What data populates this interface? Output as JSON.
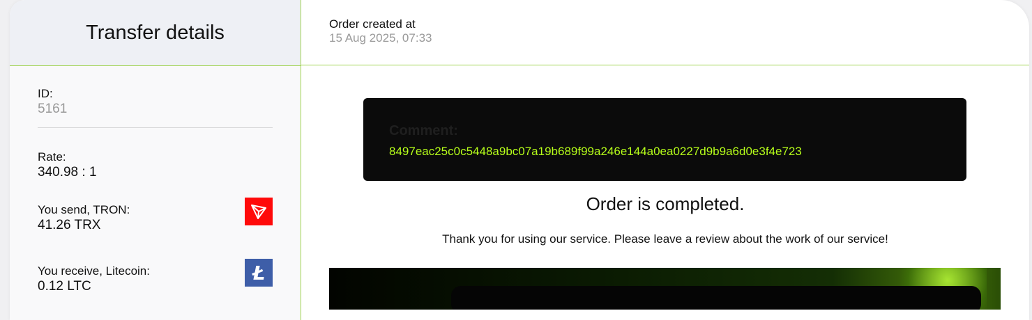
{
  "transfer": {
    "title": "Transfer details",
    "id_label": "ID:",
    "id_value": "5161",
    "rate_label": "Rate:",
    "rate_value": "340.98 : 1",
    "send_label": "You send, TRON:",
    "send_value": "41.26 TRX",
    "send_icon": "tron-icon",
    "receive_label": "You receive, Litecoin:",
    "receive_value": "0.12 LTC",
    "receive_icon": "litecoin-icon",
    "receive_icon_glyph": "Ł"
  },
  "order": {
    "created_label": "Order created at",
    "created_value": "15 Aug 2025, 07:33",
    "comment_label": "Comment:",
    "comment_value": "8497eac25c0c5448a9bc07a19b689f99a246e144a0ea0227d9b9a6d0e3f4e723",
    "status": "Order is completed.",
    "thanks": "Thank you for using our service. Please leave a review about the work of our service!"
  },
  "colors": {
    "accent_green": "#9fd34f",
    "comment_text": "#b7ff1a",
    "tron_red": "#ff0a0a",
    "litecoin_blue": "#3e5ea8"
  }
}
